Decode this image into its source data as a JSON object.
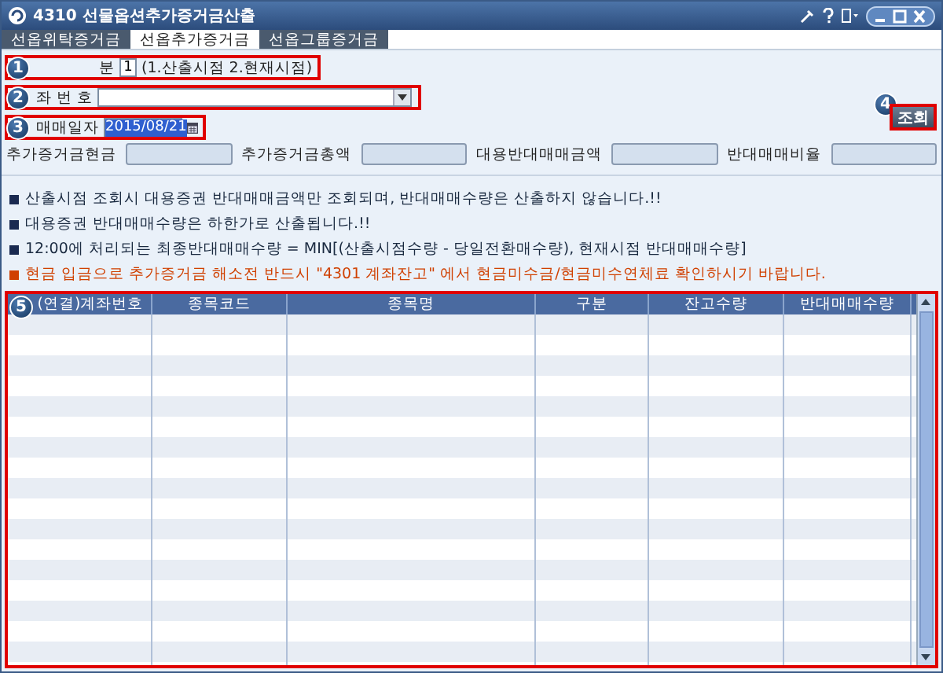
{
  "window": {
    "title": "4310 선물옵션추가증거금산출"
  },
  "tabs": [
    {
      "label": "선옵위탁증거금",
      "selected": false
    },
    {
      "label": "선옵추가증거금",
      "selected": true
    },
    {
      "label": "선옵그룹증거금",
      "selected": false
    }
  ],
  "form": {
    "type_row": {
      "badge": "1",
      "label": "분",
      "value": "1",
      "hint": "(1.산출시점 2.현재시점)"
    },
    "account_row": {
      "badge": "2",
      "label": "좌 번 호"
    },
    "date_row": {
      "badge": "3",
      "label": "매매일자",
      "value": "2015/08/21"
    },
    "search_button": {
      "badge": "4",
      "label": "조회"
    },
    "amount_fields": [
      {
        "label": "추가증거금현금"
      },
      {
        "label": "추가증거금총액"
      },
      {
        "label": "대용반대매매금액"
      },
      {
        "label": "반대매매비율"
      }
    ]
  },
  "notes": [
    {
      "text": "산출시점 조회시 대용증권 반대매매금액만 조회되며, 반대매매수량은 산출하지 않습니다.!!",
      "kind": "info"
    },
    {
      "text": "대용증권 반대매매수량은 하한가로 산출됩니다.!!",
      "kind": "info"
    },
    {
      "text": "12:00에 처리되는 최종반대매매수량 = MIN[(산출시점수량 - 당일전환매수량), 현재시점 반대매매수량]",
      "kind": "info"
    },
    {
      "text": "현금 입금으로 추가증거금 해소전 반드시 \"4301 계좌잔고\" 에서 현금미수금/현금미수연체료 확인하시기 바랍니다.",
      "kind": "warning"
    }
  ],
  "table": {
    "badge": "5",
    "columns": [
      "(연결)계좌번호",
      "종목코드",
      "종목명",
      "구분",
      "잔고수량",
      "반대매매수량"
    ]
  }
}
